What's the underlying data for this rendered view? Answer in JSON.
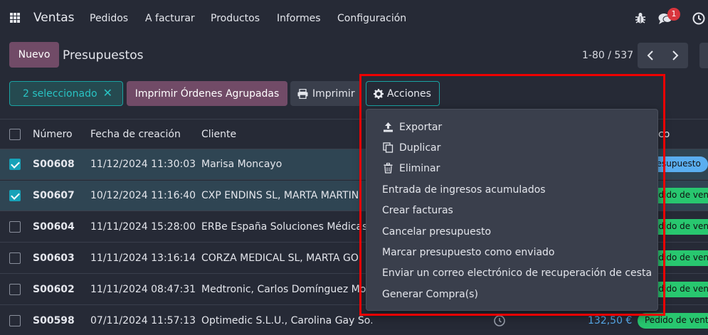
{
  "navbar": {
    "app_name": "Ventas",
    "menu": [
      "Pedidos",
      "A facturar",
      "Productos",
      "Informes",
      "Configuración"
    ],
    "icons": [
      "bug-icon",
      "chat-icon",
      "clock-icon"
    ],
    "chat_badge": "1"
  },
  "control": {
    "new_label": "Nuevo",
    "breadcrumb": "Presupuestos",
    "pager": "1-80 / 537"
  },
  "toolbar": {
    "selected_label": "2 seleccionado",
    "group_print_label": "Imprimir Órdenes Agrupadas",
    "print_label": "Imprimir",
    "actions_label": "Acciones"
  },
  "table": {
    "columns": [
      "Número",
      "Fecha de creación",
      "Cliente",
      "Estado"
    ],
    "status_header_visible": "co",
    "rows": [
      {
        "number": "S00608",
        "date": "11/12/2024 11:30:03",
        "client": "Marisa Moncayo",
        "status": "resupuesto",
        "selected": true
      },
      {
        "number": "S00607",
        "date": "10/12/2024 11:16:40",
        "client": "CXP ENDINS SL, MARTA MARTIN",
        "status": "edido de vent",
        "selected": true
      },
      {
        "number": "S00604",
        "date": "11/11/2024 15:28:00",
        "client": "ERBe España Soluciones Médicas",
        "status": "edido de vent",
        "selected": false
      },
      {
        "number": "S00603",
        "date": "11/11/2024 13:16:14",
        "client": "CORZA MEDICAL SL, MARTA GO",
        "status": "edido de vent",
        "selected": false
      },
      {
        "number": "S00602",
        "date": "11/11/2024 08:47:31",
        "client": "Medtronic, Carlos Domínguez Mo",
        "status": "edido de vent",
        "selected": false
      },
      {
        "number": "S00598",
        "date": "07/11/2024 11:57:13",
        "client": "Optimedic S.L.U., Carolina Gay So…",
        "amount": "132,50 €",
        "status": "Pedido de vent",
        "selected": false
      }
    ]
  },
  "actions_menu": [
    {
      "label": "Exportar",
      "icon": "upload-icon"
    },
    {
      "label": "Duplicar",
      "icon": "copy-icon"
    },
    {
      "label": "Eliminar",
      "icon": "trash-icon"
    },
    {
      "label": "Entrada de ingresos acumulados"
    },
    {
      "label": "Crear facturas"
    },
    {
      "label": "Cancelar presupuesto"
    },
    {
      "label": "Marcar presupuesto como enviado"
    },
    {
      "label": "Enviar un correo electrónico de recuperación de cesta"
    },
    {
      "label": "Generar Compra(s)"
    }
  ],
  "colors": {
    "brand": "#714b67",
    "accent": "#1aa3a3",
    "highlight": "#ee0000",
    "status_quote": "#5aaef0",
    "status_order": "#28c76f"
  }
}
